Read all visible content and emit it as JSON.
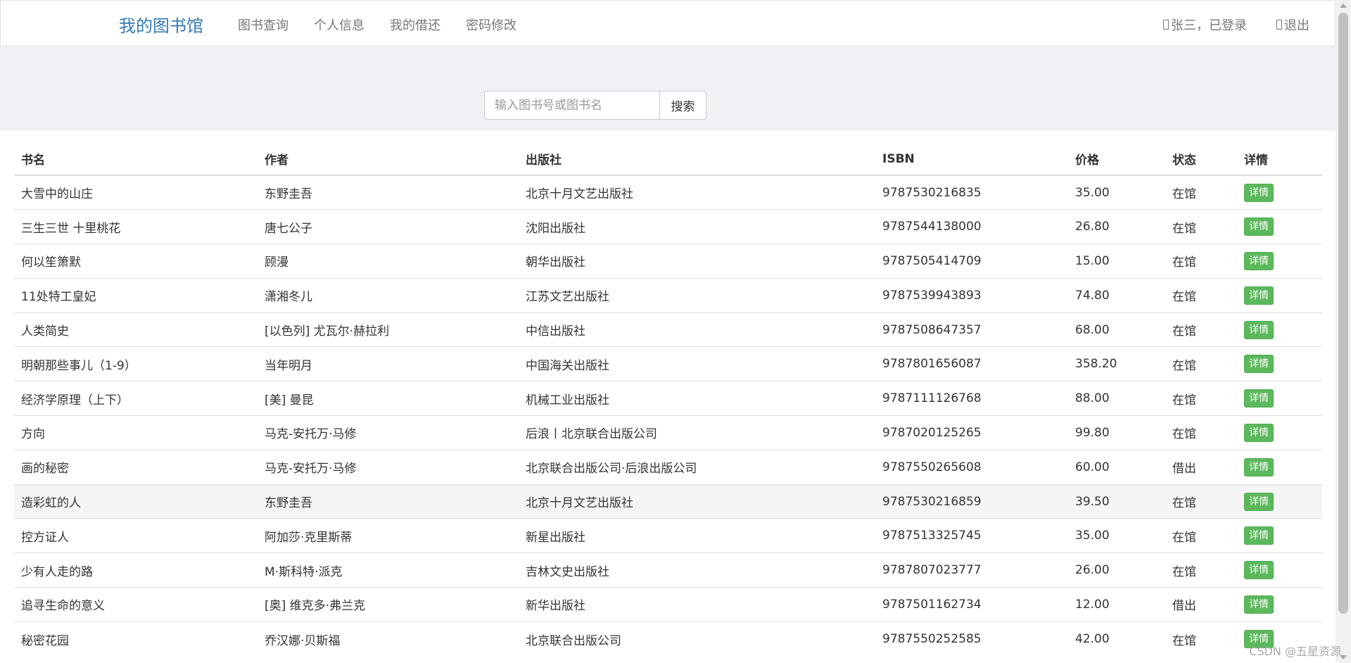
{
  "navbar": {
    "brand": "我的图书馆",
    "links": [
      "图书查询",
      "个人信息",
      "我的借还",
      "密码修改"
    ],
    "user_status": "张三，已登录",
    "logout": "退出"
  },
  "search": {
    "placeholder": "输入图书号或图书名",
    "button_label": "搜索"
  },
  "table": {
    "headers": [
      "书名",
      "作者",
      "出版社",
      "ISBN",
      "价格",
      "状态",
      "详情"
    ],
    "detail_label": "详情",
    "rows": [
      [
        "大雪中的山庄",
        "东野圭吾",
        "北京十月文艺出版社",
        "9787530216835",
        "35.00",
        "在馆"
      ],
      [
        "三生三世 十里桃花",
        "唐七公子",
        "沈阳出版社",
        "9787544138000",
        "26.80",
        "在馆"
      ],
      [
        "何以笙箫默",
        "顾漫",
        "朝华出版社",
        "9787505414709",
        "15.00",
        "在馆"
      ],
      [
        "11处特工皇妃",
        "潇湘冬儿",
        "江苏文艺出版社",
        "9787539943893",
        "74.80",
        "在馆"
      ],
      [
        "人类简史",
        "[以色列] 尤瓦尔·赫拉利",
        "中信出版社",
        "9787508647357",
        "68.00",
        "在馆"
      ],
      [
        "明朝那些事儿（1-9）",
        "当年明月",
        "中国海关出版社",
        "9787801656087",
        "358.20",
        "在馆"
      ],
      [
        "经济学原理（上下）",
        "[美] 曼昆",
        "机械工业出版社",
        "9787111126768",
        "88.00",
        "在馆"
      ],
      [
        "方向",
        "马克-安托万·马修",
        "后浪丨北京联合出版公司",
        "9787020125265",
        "99.80",
        "在馆"
      ],
      [
        "画的秘密",
        "马克-安托万·马修",
        "北京联合出版公司·后浪出版公司",
        "9787550265608",
        "60.00",
        "借出"
      ],
      [
        "造彩虹的人",
        "东野圭吾",
        "北京十月文艺出版社",
        "9787530216859",
        "39.50",
        "在馆"
      ],
      [
        "控方证人",
        "阿加莎·克里斯蒂",
        "新星出版社",
        "9787513325745",
        "35.00",
        "在馆"
      ],
      [
        "少有人走的路",
        "M·斯科特·派克",
        "吉林文史出版社",
        "9787807023777",
        "26.00",
        "在馆"
      ],
      [
        "追寻生命的意义",
        "[奥] 维克多·弗兰克",
        "新华出版社",
        "9787501162734",
        "12.00",
        "借出"
      ],
      [
        "秘密花园",
        "乔汉娜·贝斯福",
        "北京联合出版公司",
        "9787550252585",
        "42.00",
        "在馆"
      ]
    ],
    "hover_row_index": 9
  },
  "watermark": "CSDN @五星资源",
  "colors": {
    "brand": "#337ab7",
    "detail_button": "#5cb85c",
    "page_background": "#eff1f5"
  }
}
